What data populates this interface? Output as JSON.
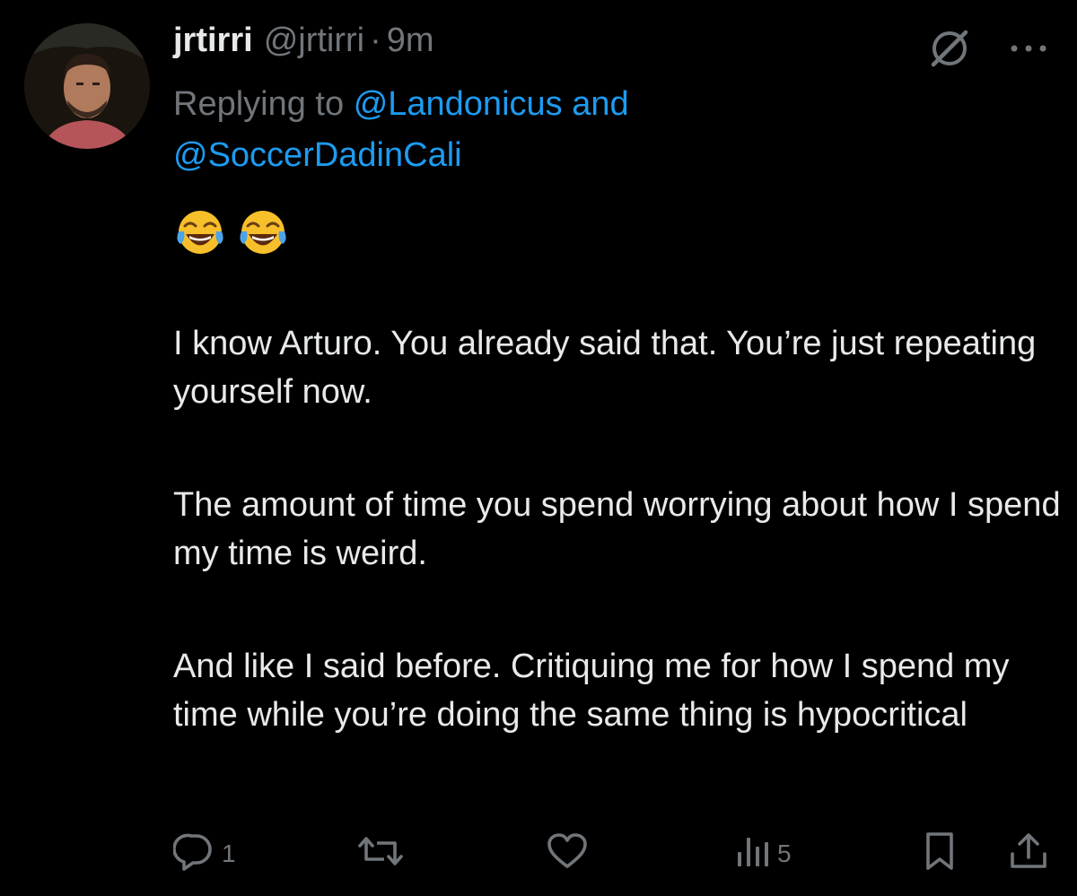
{
  "tweet": {
    "display_name": "jrtirri",
    "handle": "@jrtirri",
    "separator": "·",
    "time": "9m",
    "replying_prefix": "Replying to",
    "mentions": [
      "@Landonicus",
      "@SoccerDadinCali"
    ],
    "mention_joiner": "and",
    "emoji": [
      "😂",
      "😂"
    ],
    "body_paragraphs": [
      "I know Arturo. You already said that. You’re just repeating yourself now.",
      "The amount of time you spend worrying about how I spend my time is weird.",
      "And like I said before. Critiquing me for how I spend my time while you’re doing the same thing is hypocritical"
    ]
  },
  "actions": {
    "reply_count": "1",
    "repost_count": "",
    "like_count": "",
    "views_count": "5"
  },
  "icons": {
    "grok": "grok-icon",
    "more": "more-icon",
    "reply": "reply-icon",
    "repost": "repost-icon",
    "like": "heart-icon",
    "views": "views-icon",
    "bookmark": "bookmark-icon",
    "share": "share-icon"
  },
  "colors": {
    "background": "#000000",
    "primary_text": "#e7e9ea",
    "secondary_text": "#71767b",
    "link": "#1d9bf0"
  }
}
